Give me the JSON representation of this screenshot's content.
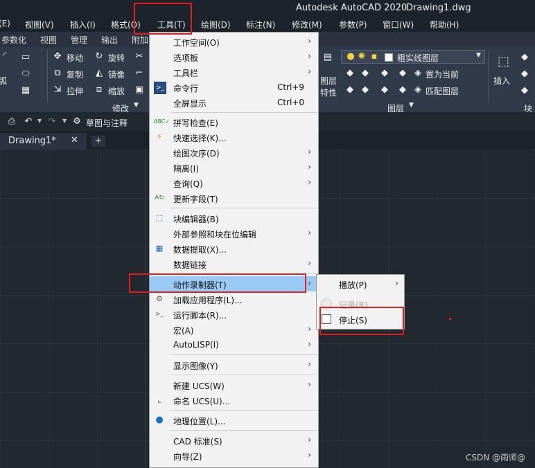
{
  "app": {
    "title": "Autodesk AutoCAD 2020",
    "file": "Drawing1.dwg"
  },
  "menubar": [
    "(E)",
    "视图(V)",
    "插入(I)",
    "格式(O)",
    "工具(T)",
    "绘图(D)",
    "标注(N)",
    "修改(M)",
    "参数(P)",
    "窗口(W)",
    "帮助(H)"
  ],
  "ribbon_tabs": [
    "参数化",
    "视图",
    "管理",
    "输出",
    "附加"
  ],
  "ribbon": {
    "modify": {
      "move": "移动",
      "rotate": "旋转",
      "copy": "复制",
      "mirror": "镜像",
      "stretch": "拉伸",
      "scale": "缩放",
      "panel_title": "修改",
      "arc_partial": "弧"
    },
    "layer": {
      "current_layer": "粗实线图层",
      "layer_props_1": "图层",
      "layer_props_2": "特性",
      "set_current": "置为当前",
      "match_layer": "匹配图层",
      "panel_title": "图层"
    },
    "block": {
      "insert": "插入",
      "panel_title": "块"
    }
  },
  "quick_access": {
    "workspace": "草图与注释"
  },
  "doc_tab": {
    "name": "Drawing1*"
  },
  "menu": {
    "items": [
      {
        "label": "工作空间(O)",
        "arrow": true
      },
      {
        "label": "选项板",
        "arrow": true
      },
      {
        "label": "工具栏",
        "arrow": true
      },
      {
        "label": "命令行",
        "shortcut": "Ctrl+9"
      },
      {
        "label": "全屏显示",
        "shortcut": "Ctrl+0"
      },
      {
        "label": "拼写检查(E)"
      },
      {
        "label": "快速选择(K)..."
      },
      {
        "label": "绘图次序(D)",
        "arrow": true
      },
      {
        "label": "隔离(I)",
        "arrow": true
      },
      {
        "label": "查询(Q)",
        "arrow": true
      },
      {
        "label": "更新字段(T)"
      },
      {
        "label": "块编辑器(B)"
      },
      {
        "label": "外部参照和块在位编辑",
        "arrow": true
      },
      {
        "label": "数据提取(X)..."
      },
      {
        "label": "数据链接",
        "arrow": true
      },
      {
        "label": "动作录制器(T)",
        "arrow": true
      },
      {
        "label": "加载应用程序(L)..."
      },
      {
        "label": "运行脚本(R)..."
      },
      {
        "label": "宏(A)",
        "arrow": true
      },
      {
        "label": "AutoLISP(I)",
        "arrow": true
      },
      {
        "label": "显示图像(Y)",
        "arrow": true
      },
      {
        "label": "新建 UCS(W)",
        "arrow": true
      },
      {
        "label": "命名 UCS(U)..."
      },
      {
        "label": "地理位置(L)..."
      },
      {
        "label": "CAD 标准(S)",
        "arrow": true
      },
      {
        "label": "向导(Z)",
        "arrow": true
      }
    ]
  },
  "submenu": {
    "items": [
      {
        "label": "播放(P)",
        "arrow": true
      },
      {
        "label": "记录(R)",
        "disabled": true
      },
      {
        "label": "停止(S)"
      }
    ]
  },
  "watermark": "CSDN @雨师@",
  "colors": {
    "highlight": "#99c9f5",
    "annotation_red": "#e02020",
    "menu_bg": "#f2f2f2"
  }
}
